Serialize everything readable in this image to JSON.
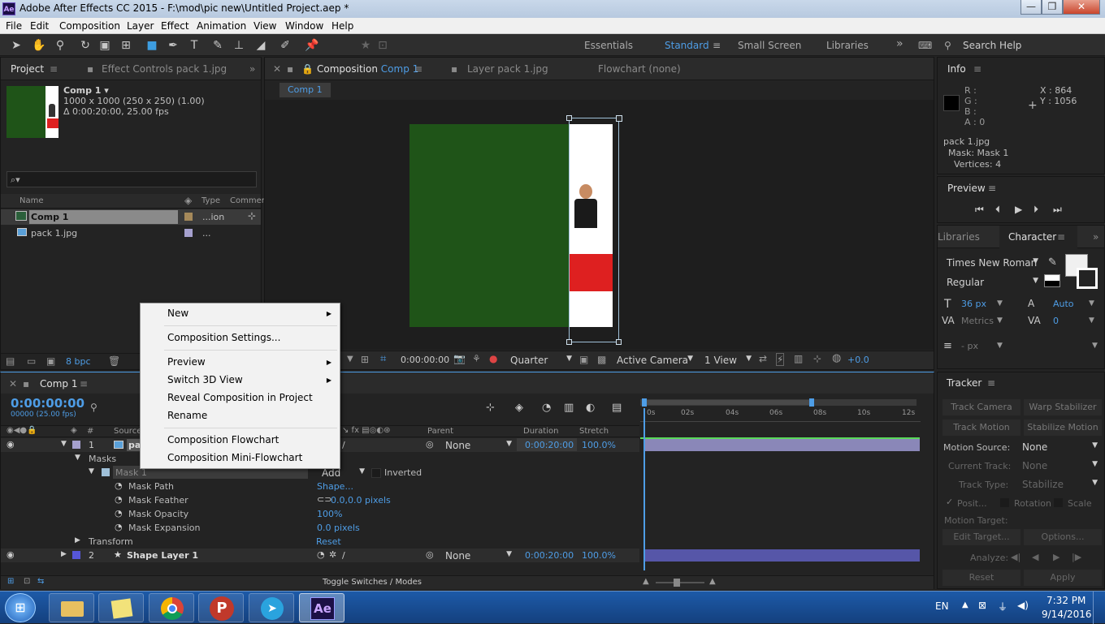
{
  "window": {
    "title": "Adobe After Effects CC 2015 - F:\\mod\\pic new\\Untitled Project.aep *",
    "min": "—",
    "max": "❒",
    "close": "✕"
  },
  "menu": [
    "File",
    "Edit",
    "Composition",
    "Layer",
    "Effect",
    "Animation",
    "View",
    "Window",
    "Help"
  ],
  "workspaces": {
    "essentials": "Essentials",
    "standard": "Standard",
    "small_screen": "Small Screen",
    "libraries": "Libraries",
    "more": "»",
    "search": "Search Help"
  },
  "project_panel": {
    "tab": "Project",
    "effect_controls_tab": "Effect Controls pack 1.jpg",
    "comp_name": "Comp 1 ▾",
    "comp_dims": "1000 x 1000  (250 x 250) (1.00)",
    "comp_duration": "Δ 0:00:20:00, 25.00 fps",
    "search_icon": "⌕▾",
    "col_name": "Name",
    "col_type": "Type",
    "col_comment": "Comment",
    "items": [
      {
        "name": "Comp 1",
        "type": "...ion",
        "color": "#a5895a"
      },
      {
        "name": "pack 1.jpg",
        "type": "...",
        "color": "#a5a0ce"
      }
    ],
    "bpc": "8 bpc"
  },
  "comp_panel": {
    "tab_prefix": "Composition",
    "tab_name": "Comp 1",
    "layer_tab": "Layer pack 1.jpg",
    "flowchart_tab": "Flowchart (none)",
    "crumb": "Comp 1",
    "timecode": "0:00:00:00",
    "quality": "Quarter",
    "camera": "Active Camera",
    "views": "1 View",
    "exposure": "+0.0"
  },
  "context_menu": {
    "items": [
      {
        "label": "New",
        "sub": true
      },
      {
        "label": "Composition Settings...",
        "sub": false
      },
      {
        "label": "Preview",
        "sub": true
      },
      {
        "label": "Switch 3D View",
        "sub": true
      },
      {
        "label": "Reveal Composition in Project",
        "sub": false
      },
      {
        "label": "Rename",
        "sub": false
      },
      {
        "label": "Composition Flowchart",
        "sub": false
      },
      {
        "label": "Composition Mini-Flowchart",
        "sub": false
      }
    ]
  },
  "info": {
    "tab": "Info",
    "r": "R :",
    "g": "G :",
    "b": "B :",
    "a": "A : 0",
    "x": "X : 864",
    "y": "Y : 1056",
    "line1": "pack 1.jpg",
    "line2": "Mask: Mask 1",
    "line3": "Vertices: 4"
  },
  "preview": {
    "tab": "Preview"
  },
  "character": {
    "libraries_tab": "Libraries",
    "tab": "Character",
    "font": "Times New Roman",
    "style": "Regular",
    "size": "36 px",
    "leading": "Auto",
    "kerning": "Metrics",
    "tracking": "0",
    "indent": "- px"
  },
  "tracker": {
    "tab": "Tracker",
    "track_camera": "Track Camera",
    "warp_stabilizer": "Warp Stabilizer",
    "track_motion": "Track Motion",
    "stabilize_motion": "Stabilize Motion",
    "motion_source_label": "Motion Source:",
    "motion_source": "None",
    "current_track_label": "Current Track:",
    "current_track": "None",
    "track_type_label": "Track Type:",
    "track_type": "Stabilize",
    "position": "Posit...",
    "rotation": "Rotation",
    "scale": "Scale",
    "motion_target": "Motion Target:",
    "edit_target": "Edit Target...",
    "options": "Options...",
    "analyze": "Analyze:",
    "reset": "Reset",
    "apply": "Apply"
  },
  "timeline": {
    "tab": "Comp 1",
    "timecode": "0:00:00:00",
    "frames": "00000 (25.00 fps)",
    "col_source": "Source",
    "col_parent": "Parent",
    "col_duration": "Duration",
    "col_stretch": "Stretch",
    "ruler": [
      "0s",
      "02s",
      "04s",
      "06s",
      "08s",
      "10s",
      "12s"
    ],
    "layers": [
      {
        "num": "1",
        "name": "pack 1.jpg",
        "parent": "None",
        "duration": "0:00:20:00",
        "stretch": "100.0%"
      },
      {
        "num": "2",
        "name": "Shape Layer 1",
        "parent": "None",
        "duration": "0:00:20:00",
        "stretch": "100.0%"
      }
    ],
    "masks": "Masks",
    "mask1": "Mask 1",
    "mask_mode": "Add",
    "inverted": "Inverted",
    "props": [
      {
        "name": "Mask Path",
        "value": "Shape..."
      },
      {
        "name": "Mask Feather",
        "value": "0.0,0.0 pixels"
      },
      {
        "name": "Mask Opacity",
        "value": "100%"
      },
      {
        "name": "Mask Expansion",
        "value": "0.0 pixels"
      }
    ],
    "transform": "Transform",
    "transform_value": "Reset",
    "toggle": "Toggle Switches / Modes"
  },
  "taskbar": {
    "lang": "EN",
    "time": "7:32 PM",
    "date": "9/14/2016",
    "apps": [
      "windows-explorer",
      "sticky-notes",
      "chrome",
      "p-app",
      "telegram",
      "after-effects"
    ]
  },
  "colors": {
    "accent": "#4e9de6",
    "comp_green": "#1f5418",
    "flag_red": "#de2020",
    "ae_purple": "#9999ff"
  }
}
